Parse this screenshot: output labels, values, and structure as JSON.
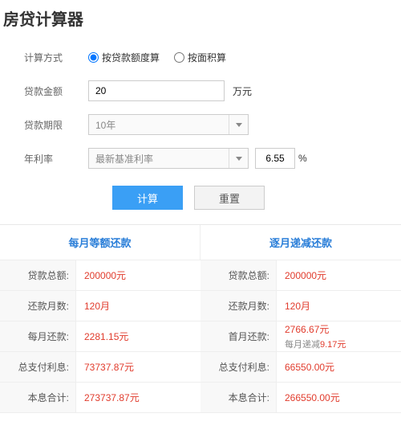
{
  "title": "房贷计算器",
  "form": {
    "calc_method_label": "计算方式",
    "radio_by_amount": "按贷款额度算",
    "radio_by_area": "按面积算",
    "loan_amount_label": "贷款金额",
    "loan_amount_value": "20",
    "loan_amount_unit": "万元",
    "loan_term_label": "贷款期限",
    "loan_term_value": "10年",
    "rate_label": "年利率",
    "rate_select_text": "最新基准利率",
    "rate_value": "6.55",
    "rate_unit": "%",
    "calc_btn": "计算",
    "reset_btn": "重置"
  },
  "results": {
    "equal": {
      "header": "每月等额还款",
      "rows": {
        "total_loan_label": "贷款总额:",
        "total_loan_value": "200000元",
        "months_label": "还款月数:",
        "months_value": "120月",
        "monthly_label": "每月还款:",
        "monthly_value": "2281.15元",
        "interest_label": "总支付利息:",
        "interest_value": "73737.87元",
        "sum_label": "本息合计:",
        "sum_value": "273737.87元"
      }
    },
    "decreasing": {
      "header": "逐月递减还款",
      "rows": {
        "total_loan_label": "贷款总额:",
        "total_loan_value": "200000元",
        "months_label": "还款月数:",
        "months_value": "120月",
        "first_label": "首月还款:",
        "first_value": "2766.67元",
        "first_sub_prefix": "每月递减",
        "first_sub_amount": "9.17元",
        "interest_label": "总支付利息:",
        "interest_value": "66550.00元",
        "sum_label": "本息合计:",
        "sum_value": "266550.00元"
      }
    }
  }
}
